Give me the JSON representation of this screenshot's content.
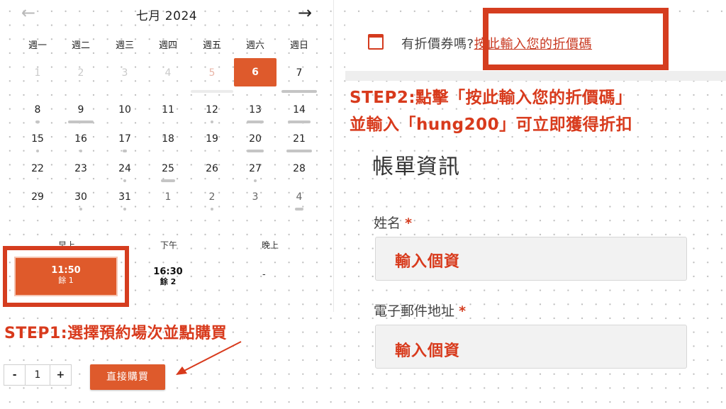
{
  "calendar": {
    "month_title": "七月 2024",
    "prev_icon": "arrow-left-icon",
    "next_icon": "arrow-right-icon",
    "weekdays": [
      "週一",
      "週二",
      "週三",
      "週四",
      "週五",
      "週六",
      "週日"
    ],
    "days": [
      [
        "1",
        "2",
        "3",
        "4",
        "5",
        "6",
        "7"
      ],
      [
        "8",
        "9",
        "10",
        "11",
        "12",
        "13",
        "14"
      ],
      [
        "15",
        "16",
        "17",
        "18",
        "19",
        "20",
        "21"
      ],
      [
        "22",
        "23",
        "24",
        "25",
        "26",
        "27",
        "28"
      ],
      [
        "29",
        "30",
        "31",
        "1",
        "2",
        "3",
        "4"
      ]
    ],
    "selected_day": "6",
    "accent_color": "#de5a2c"
  },
  "timeslots": {
    "morning_label": "早上",
    "afternoon_label": "下午",
    "evening_label": "晚上",
    "morning_slot": {
      "time": "11:50",
      "remaining": "餘 1"
    },
    "afternoon_slot": {
      "time": "16:30",
      "remaining": "餘 2"
    },
    "evening_slot": "-"
  },
  "purchase": {
    "minus": "-",
    "quantity": "1",
    "plus": "+",
    "buy_label": "直接購買"
  },
  "annotations": {
    "step1": "STEP1:選擇預約場次並點購買",
    "step2_line1": "STEP2:點擊「按此輸入您的折價碼」",
    "step2_line2": "並輸入「hung200」可立即獲得折扣",
    "highlight_color": "#d53d1f"
  },
  "coupon": {
    "prompt": "有折價券嗎?",
    "link": "按此輸入您的折價碼"
  },
  "billing": {
    "title": "帳單資訊",
    "name_label": "姓名",
    "name_required": "*",
    "name_value": "輸入個資",
    "email_label": "電子郵件地址",
    "email_required": "*",
    "email_value": "輸入個資"
  }
}
